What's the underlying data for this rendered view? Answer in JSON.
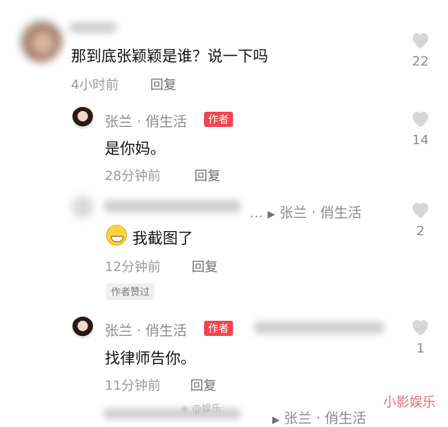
{
  "comments": [
    {
      "username": "",
      "content": "那到底张颖颖是谁？说一下吗",
      "time": "4小时前",
      "reply_label": "回复",
      "likes": "22"
    },
    {
      "username": "张兰 · 俏生活",
      "author_badge": "作者",
      "content": "是你妈。",
      "time": "28分钟前",
      "reply_label": "回复",
      "likes": "14"
    },
    {
      "username": "",
      "reply_to": "张兰 · 俏生活",
      "content": "我截图了",
      "time": "12分钟前",
      "reply_label": "回复",
      "liked_by_author": "作者赞过",
      "likes": "2"
    },
    {
      "username": "张兰 · 俏生活",
      "author_badge": "作者",
      "content": "找律师告你。",
      "time": "11分钟前",
      "reply_label": "回复",
      "likes": "1"
    },
    {
      "reply_to": "张兰 · 俏生活"
    }
  ],
  "watermarks": {
    "corner": "小影娱乐",
    "weibo": "@娱乐"
  },
  "colors": {
    "author_badge": "#f2454d",
    "like_icon": "#d6d6d6",
    "watermark": "#f06a6a"
  },
  "icons": {
    "like": "heart-icon",
    "reply_arrow": "triangle-right-icon",
    "emoji": "grinning-face-icon"
  }
}
